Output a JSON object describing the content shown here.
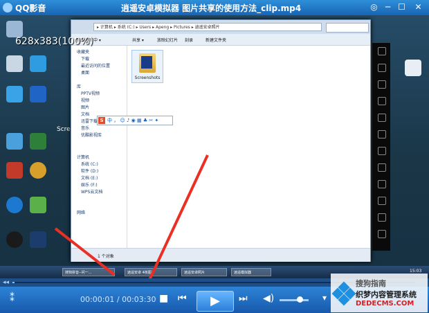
{
  "titlebar": {
    "app_name": "QQ影音",
    "title": "逍遥安卓模拟器 图片共享的使用方法_clip.mp4",
    "buttons": [
      "◎",
      "─",
      "☐",
      "✕"
    ]
  },
  "video": {
    "zoom_label": "628x383(100%)",
    "screen_label": "Scree",
    "explorer": {
      "address": "▸ 计算机 ▸ 系统 (C:) ▸ Users ▸ Apeng ▸ Pictures ▸ 逍遥安卓照片",
      "toolbar": [
        "包含到库中 ▾",
        "共享 ▾",
        "放映幻灯片",
        "刻录",
        "新建文件夹"
      ],
      "nav": {
        "favorites": [
          "收藏夹",
          "下载",
          "最近访问的位置",
          "桌面"
        ],
        "libraries": [
          "库",
          "PPTV视频",
          "视频",
          "图片",
          "文档",
          "迅雷下载",
          "音乐",
          "优酷影视库"
        ],
        "computer": [
          "计算机",
          "系统 (C:)",
          "软件 (D:)",
          "文档 (E:)",
          "娱乐 (F:)",
          "WPS云文档"
        ],
        "network": [
          "网络"
        ]
      },
      "folder_label": "Screenshots",
      "status": "1 个对象",
      "ime": "中 ， ☺ ♪ ◉ ▦ ♣ ✂ ✦"
    },
    "taskbar": {
      "items": [
        "搜狗拼音--问一...",
        "逍遥安卓 4核图片",
        "逍遥安卓照片",
        "逍遥模拟器"
      ],
      "clock": "15:03"
    }
  },
  "player": {
    "progress": 0.005,
    "time": "00:00:01 / 00:03:30",
    "volume": 0.7,
    "play": "▶",
    "stop": "■",
    "prev": "⏮",
    "next": "⏭",
    "menu": "▾"
  },
  "watermark": {
    "title": "搜狗指南",
    "subtitle": "织梦内容管理系统",
    "url": "DEDECMS.COM"
  },
  "colors": {
    "titlebar": "#1f78c8",
    "controls": "#2170c4",
    "arrow": "#ea2f24"
  }
}
